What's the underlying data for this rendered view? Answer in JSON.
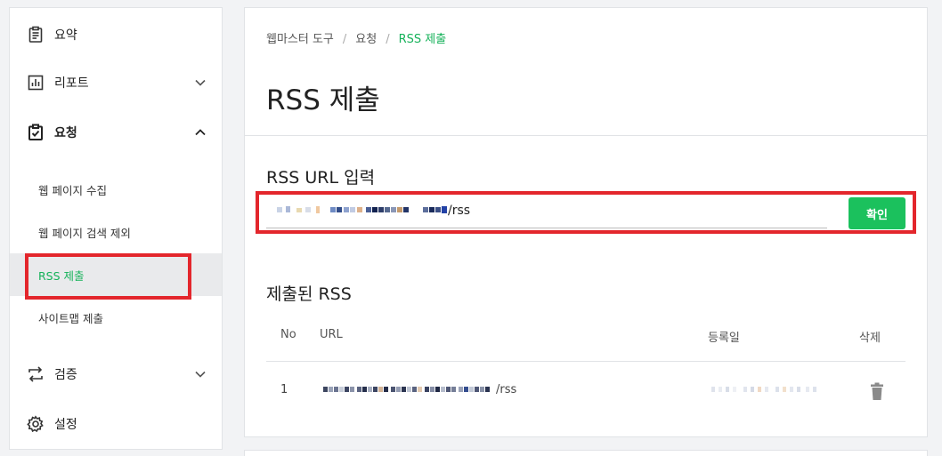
{
  "sidebar": {
    "items": [
      {
        "label": "요약",
        "icon": "clipboard-list-icon"
      },
      {
        "label": "리포트",
        "icon": "bar-chart-icon"
      },
      {
        "label": "요청",
        "icon": "clipboard-check-icon"
      },
      {
        "label": "검증",
        "icon": "swap-arrows-icon"
      },
      {
        "label": "설정",
        "icon": "gear-icon"
      }
    ],
    "request_sub": [
      {
        "label": "웹 페이지 수집"
      },
      {
        "label": "웹 페이지 검색 제외"
      },
      {
        "label": "RSS 제출"
      },
      {
        "label": "사이트맵 제출"
      }
    ]
  },
  "breadcrumb": [
    "웹마스터 도구",
    "요청",
    "RSS 제출"
  ],
  "page_title": "RSS 제출",
  "input_section": {
    "title": "RSS URL 입력",
    "value_suffix": "/rss",
    "confirm_label": "확인"
  },
  "submitted": {
    "title": "제출된 RSS",
    "columns": [
      "No",
      "URL",
      "등록일",
      "삭제"
    ],
    "rows": [
      {
        "no": "1",
        "url_suffix": "/rss"
      }
    ]
  },
  "colors": {
    "accent": "#16b25a",
    "button": "#1bc15d",
    "highlight": "#e3262c"
  }
}
